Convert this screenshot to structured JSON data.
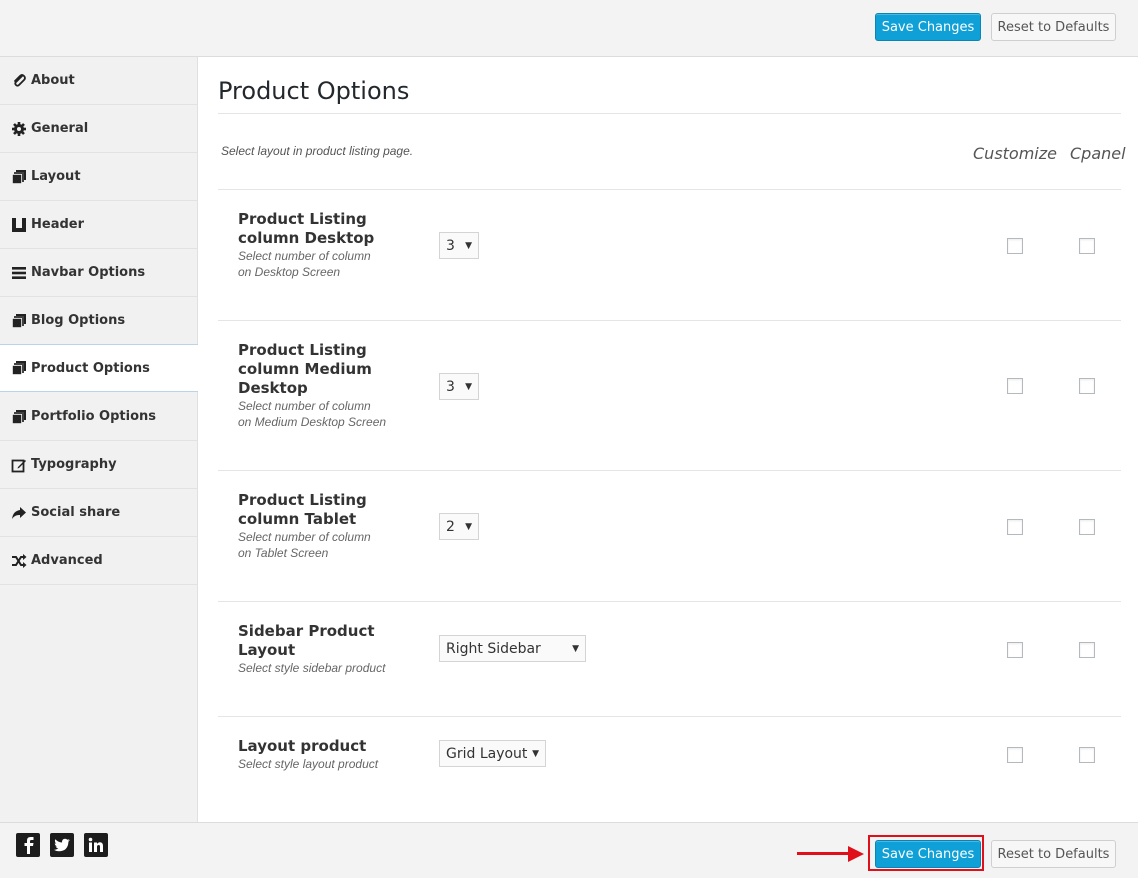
{
  "toolbar": {
    "save_label": "Save Changes",
    "reset_label": "Reset to Defaults"
  },
  "sidebar": {
    "items": [
      {
        "label": "About",
        "icon": "paperclip-icon"
      },
      {
        "label": "General",
        "icon": "gear-icon"
      },
      {
        "label": "Layout",
        "icon": "copy-icon"
      },
      {
        "label": "Header",
        "icon": "header-icon"
      },
      {
        "label": "Navbar Options",
        "icon": "bars-icon"
      },
      {
        "label": "Blog Options",
        "icon": "copy-icon"
      },
      {
        "label": "Product Options",
        "icon": "copy-icon",
        "active": true
      },
      {
        "label": "Portfolio Options",
        "icon": "copy-icon"
      },
      {
        "label": "Typography",
        "icon": "edit-icon"
      },
      {
        "label": "Social share",
        "icon": "share-icon"
      },
      {
        "label": "Advanced",
        "icon": "shuffle-icon"
      }
    ]
  },
  "main": {
    "title": "Product Options",
    "intro": "Select layout in product listing page.",
    "col_customize": "Customize",
    "col_cpanel": "Cpanel",
    "rows": [
      {
        "label_lines": [
          "Product Listing",
          "column Desktop"
        ],
        "desc_lines": [
          "Select number of column",
          "on Desktop Screen"
        ],
        "value": "3",
        "customize": false,
        "cpanel": false
      },
      {
        "label_lines": [
          "Product Listing",
          "column Medium",
          "Desktop"
        ],
        "desc_lines": [
          "Select number of column",
          "on Medium Desktop Screen"
        ],
        "value": "3",
        "customize": false,
        "cpanel": false
      },
      {
        "label_lines": [
          "Product Listing",
          "column Tablet"
        ],
        "desc_lines": [
          "Select number of column",
          "on Tablet Screen"
        ],
        "value": "2",
        "customize": false,
        "cpanel": false
      },
      {
        "label_lines": [
          "Sidebar Product",
          "Layout"
        ],
        "desc_lines": [
          "Select style sidebar product"
        ],
        "value": "Right Sidebar",
        "customize": false,
        "cpanel": false
      },
      {
        "label_lines": [
          "Layout product"
        ],
        "desc_lines": [
          "Select style layout product"
        ],
        "value": "Grid Layout",
        "customize": false,
        "cpanel": false
      }
    ]
  },
  "footer": {
    "social": [
      "facebook-icon",
      "twitter-icon",
      "linkedin-icon"
    ],
    "save_label": "Save Changes",
    "reset_label": "Reset to Defaults"
  },
  "colors": {
    "primary": "#0ea0d6",
    "highlight": "#e0101b"
  }
}
